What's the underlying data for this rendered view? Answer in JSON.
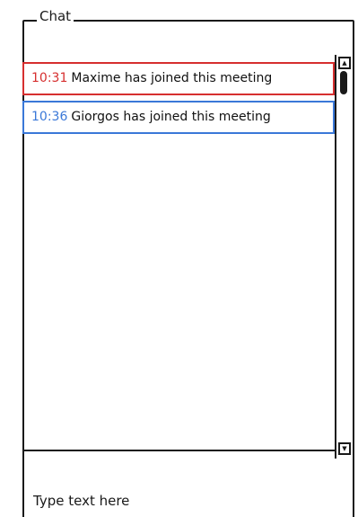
{
  "panel": {
    "title": "Chat"
  },
  "messages": [
    {
      "time": "10:31",
      "text": "Maxime has joined this meeting",
      "color": "#d62f2f"
    },
    {
      "time": "10:36",
      "text": "Giorgos has joined this meeting",
      "color": "#3a78d8"
    }
  ],
  "input": {
    "placeholder": "Type text here"
  },
  "icons": {
    "scroll_up": "scroll-up-icon",
    "scroll_down": "scroll-down-icon"
  }
}
